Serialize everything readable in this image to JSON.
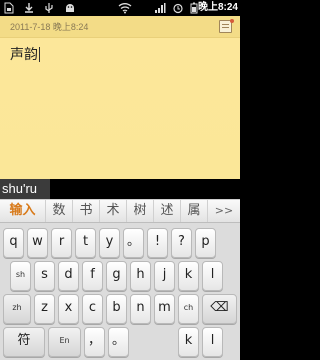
{
  "status_bar": {
    "icons": [
      "sim-icon",
      "download-icon",
      "usb-icon",
      "android-debug-icon",
      "wifi-icon",
      "signal-icon",
      "alarm-icon"
    ],
    "time": "晚上8:24"
  },
  "note": {
    "date": "2011-7-18  晚上8:24",
    "content": "声韵"
  },
  "composition": "shu'ru",
  "candidates": {
    "items": [
      "输入",
      "数",
      "书",
      "术",
      "树",
      "述",
      "属"
    ],
    "more_label": ">>"
  },
  "keyboard": {
    "row1": [
      {
        "main": "q",
        "alt": ""
      },
      {
        "main": "w",
        "alt": ""
      },
      {
        "main": "r",
        "alt": ""
      },
      {
        "main": "t",
        "alt": ""
      },
      {
        "main": "y",
        "alt": ""
      },
      {
        "main": "。",
        "alt": ""
      },
      {
        "main": "!",
        "alt": ""
      },
      {
        "main": "?",
        "alt": ""
      },
      {
        "main": "p",
        "alt": ""
      }
    ],
    "row2": [
      {
        "main": "sh",
        "alt": "",
        "small": true
      },
      {
        "main": "s",
        "alt": ""
      },
      {
        "main": "d",
        "alt": ""
      },
      {
        "main": "f",
        "alt": ""
      },
      {
        "main": "g",
        "alt": ""
      },
      {
        "main": "h",
        "alt": ""
      },
      {
        "main": "j",
        "alt": ""
      },
      {
        "main": "k",
        "alt": ""
      },
      {
        "main": "l",
        "alt": ""
      }
    ],
    "row3": [
      {
        "main": "zh",
        "alt": "",
        "small": true
      },
      {
        "main": "z",
        "alt": ""
      },
      {
        "main": "x",
        "alt": ""
      },
      {
        "main": "c",
        "alt": ""
      },
      {
        "main": "b",
        "alt": ""
      },
      {
        "main": "n",
        "alt": ""
      },
      {
        "main": "m",
        "alt": ""
      },
      {
        "main": "ch",
        "alt": "",
        "small": true
      },
      {
        "main": "⌫",
        "alt": ""
      }
    ],
    "row4": [
      {
        "main": "符",
        "alt": ""
      },
      {
        "main": "En",
        "alt": "",
        "small": true
      },
      {
        "main": "，",
        "alt": ""
      },
      {
        "main": "。",
        "alt": ""
      },
      {
        "main": "k",
        "alt": ""
      },
      {
        "main": "l",
        "alt": ""
      }
    ]
  }
}
